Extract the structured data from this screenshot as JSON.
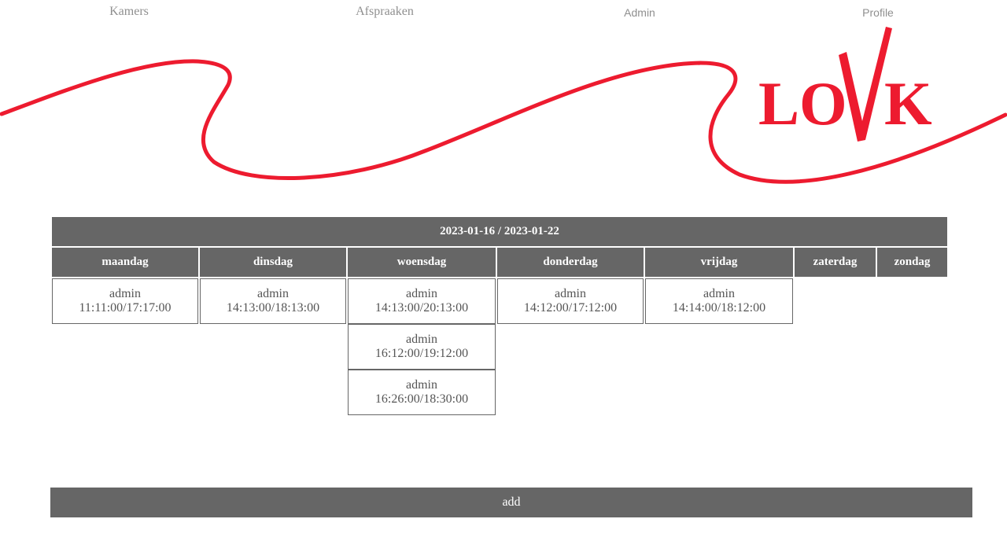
{
  "nav": {
    "kamers": "Kamers",
    "afspraken": "Afspraaken",
    "admin": "Admin",
    "profile": "Profile"
  },
  "logo": {
    "text_left": "LO",
    "text_right": "K",
    "color": "#ed1b2f"
  },
  "schedule": {
    "week": "2023-01-16 / 2023-01-22",
    "days": [
      "maandag",
      "dinsdag",
      "woensdag",
      "donderdag",
      "vrijdag",
      "zaterdag",
      "zondag"
    ],
    "slots": {
      "maandag": [
        {
          "user": "admin",
          "time": "11:11:00/17:17:00"
        }
      ],
      "dinsdag": [
        {
          "user": "admin",
          "time": "14:13:00/18:13:00"
        }
      ],
      "woensdag": [
        {
          "user": "admin",
          "time": "14:13:00/20:13:00"
        },
        {
          "user": "admin",
          "time": "16:12:00/19:12:00"
        },
        {
          "user": "admin",
          "time": "16:26:00/18:30:00"
        }
      ],
      "donderdag": [
        {
          "user": "admin",
          "time": "14:12:00/17:12:00"
        }
      ],
      "vrijdag": [
        {
          "user": "admin",
          "time": "14:14:00/18:12:00"
        }
      ],
      "zaterdag": [],
      "zondag": []
    }
  },
  "actions": {
    "add_label": "add"
  },
  "colors": {
    "header_bg": "#666666",
    "accent": "#ed1b2f",
    "nav_text": "#8f8f8f"
  }
}
